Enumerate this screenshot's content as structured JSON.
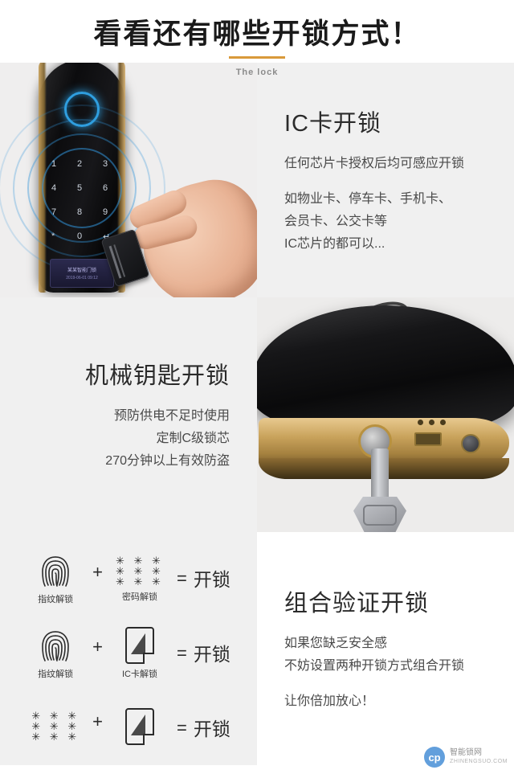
{
  "header": {
    "title": "看看还有哪些开锁方式！",
    "sub_label": "The lock"
  },
  "sections": [
    {
      "id": "ic-card",
      "title": "IC卡开锁",
      "lines": [
        "任何芯片卡授权后均可感应开锁",
        "",
        "如物业卡、停车卡、手机卡、",
        "会员卡、公交卡等",
        "IC芯片的都可以..."
      ],
      "image_caption": "智能门锁IC卡感应开锁照片"
    },
    {
      "id": "mechanical-key",
      "title": "机械钥匙开锁",
      "lines": [
        "预防供电不足时使用",
        "定制C级锁芯",
        "270分钟以上有效防盗"
      ],
      "image_caption": "智能门锁机械钥匙孔照片"
    },
    {
      "id": "combination",
      "title": "组合验证开锁",
      "lines": [
        "如果您缺乏安全感",
        "不妨设置两种开锁方式组合开锁",
        "",
        "让你倍加放心！"
      ]
    }
  ],
  "combo_rows": [
    {
      "left_icon": "fingerprint-icon",
      "left_label": "指纹解锁",
      "operator": "+",
      "right_icon": "password-stars-icon",
      "right_label": "密码解锁",
      "equals": "=",
      "result": "开锁"
    },
    {
      "left_icon": "fingerprint-icon",
      "left_label": "指纹解锁",
      "operator": "+",
      "right_icon": "ic-card-icon",
      "right_label": "IC卡解锁",
      "equals": "=",
      "result": "开锁"
    },
    {
      "left_icon": "password-stars-icon",
      "left_label": "",
      "operator": "+",
      "right_icon": "ic-card-icon",
      "right_label": "",
      "equals": "=",
      "result": "开锁"
    }
  ],
  "keypad_digits": [
    "1",
    "2",
    "3",
    "4",
    "5",
    "6",
    "7",
    "8",
    "9",
    "*",
    "0",
    "↵"
  ],
  "lock_screen": {
    "line1": "某某智能门锁",
    "line2": "2019-06-01 09:12"
  },
  "watermark": {
    "initials": "cp",
    "title": "智能锁网",
    "subtitle": "ZHINENGSUO.COM"
  },
  "colors": {
    "accent": "#d99a3a",
    "panel_gray": "#f0f0f0",
    "text_dark": "#2b2b2b",
    "text_body": "#4a4a4a",
    "glow_blue": "#2f9fe0"
  }
}
